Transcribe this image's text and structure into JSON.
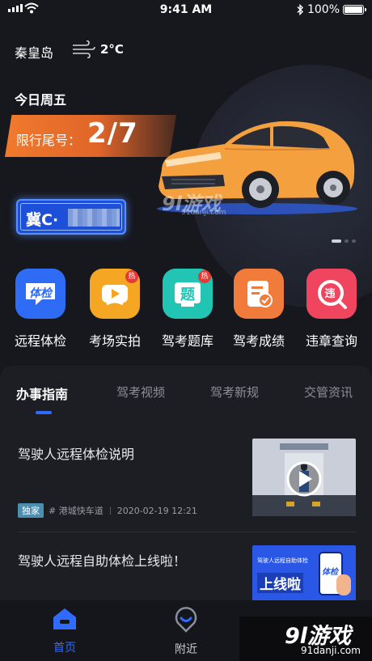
{
  "status_bar": {
    "time": "9:41 AM",
    "battery": "100%",
    "battery_level": 1.0
  },
  "header": {
    "city": "秦皇岛",
    "temperature": "2°C",
    "weather_icon": "wind-icon",
    "day": "今日周五"
  },
  "restriction": {
    "label": "限行尾号：",
    "numbers": "2/7"
  },
  "plate": {
    "prefix": "冀C·"
  },
  "carousel": {
    "count": 3,
    "active": 0
  },
  "services": [
    {
      "label": "远程体检",
      "icon": "remote-check-icon",
      "icon_text": "体检",
      "color": "#2e6cf6",
      "hot": false
    },
    {
      "label": "考场实拍",
      "icon": "video-icon",
      "color": "#f5a623",
      "hot": true
    },
    {
      "label": "驾考题库",
      "icon": "question-bank-icon",
      "icon_text": "题",
      "color": "#22c4b4",
      "hot": true
    },
    {
      "label": "驾考成绩",
      "icon": "score-icon",
      "color": "#f07b3a",
      "hot": false
    },
    {
      "label": "违章查询",
      "icon": "violation-icon",
      "icon_text": "违",
      "color": "#f0455f",
      "hot": false
    }
  ],
  "hot_badge": "热",
  "tabs": [
    {
      "label": "办事指南",
      "active": true
    },
    {
      "label": "驾考视频",
      "active": false
    },
    {
      "label": "驾考新规",
      "active": false
    },
    {
      "label": "交管资讯",
      "active": false
    }
  ],
  "news": [
    {
      "title": "驾驶人远程体检说明",
      "badge": "独家",
      "source": "# 港城快车道",
      "date": "2020-02-19 12:21"
    },
    {
      "title": "驾驶人远程自助体检上线啦！",
      "thumb_caption": "驾驶人远程自助体检",
      "thumb_headline": "上线啦",
      "thumb_icon_text": "体检"
    }
  ],
  "tabbar": [
    {
      "label": "首页",
      "icon": "home-icon",
      "active": true
    },
    {
      "label": "附近",
      "icon": "location-icon",
      "active": false
    }
  ],
  "watermark": {
    "brand": "9l游戏",
    "domain": "91danji.com"
  },
  "colors": {
    "accent": "#2f6bff",
    "orange": "#f07a2c"
  }
}
